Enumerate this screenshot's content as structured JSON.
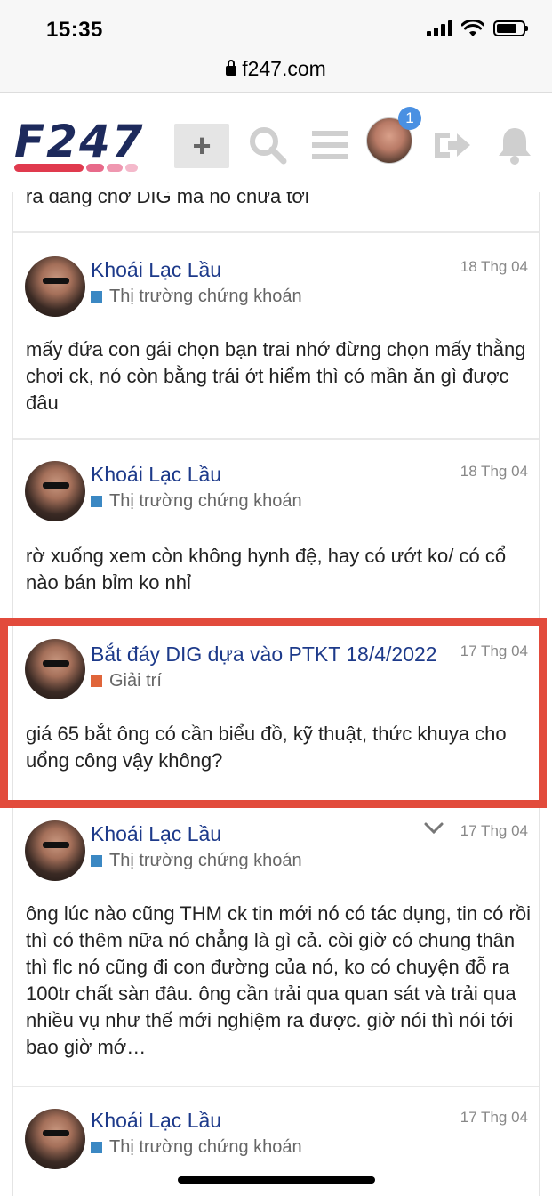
{
  "status_bar": {
    "time": "15:35"
  },
  "browser": {
    "url": "f247.com"
  },
  "header": {
    "logo_text": "F247",
    "plus_label": "+",
    "notification_count": "1",
    "icons": [
      "search-icon",
      "menu-icon",
      "avatar",
      "logout-icon",
      "bell-icon"
    ]
  },
  "feed": {
    "partial_top_text": "ra đang chờ DIG mà nó chưa tới",
    "posts": [
      {
        "title": "Khoái Lạc Lầu",
        "date": "18 Thg 04",
        "category": "Thị trường chứng khoán",
        "category_color": "#3b88c3",
        "body": "mấy đứa con gái chọn bạn trai nhớ đừng chọn mấy thằng chơi ck, nó còn bằng trái ớt hiểm thì có mần ăn gì được đâu"
      },
      {
        "title": "Khoái Lạc Lầu",
        "date": "18 Thg 04",
        "category": "Thị trường chứng khoán",
        "category_color": "#3b88c3",
        "body": "rờ xuống xem còn không hynh đệ, hay có ướt ko/ có cổ nào bán bỉm ko nhỉ"
      },
      {
        "title": "Bắt đáy DIG dựa vào PTKT 18/4/2022",
        "date": "17 Thg 04",
        "category": "Giải trí",
        "category_color": "#e0653a",
        "body": "giá 65 bắt ông có cần biểu đồ, kỹ thuật, thức khuya cho uổng công vậy không?"
      },
      {
        "title": "Khoái Lạc Lầu",
        "date": "17 Thg 04",
        "category": "Thị trường chứng khoán",
        "category_color": "#3b88c3",
        "body": "ông lúc nào cũng THM ck tin mới nó có tác dụng, tin có rồi thì có thêm nữa nó chẳng là gì cả. còi giờ có chung thân thì flc nó cũng đi con đường của nó, ko có chuyện đỗ ra 100tr chất sàn đâu. ông cần trải qua quan sát và trải qua nhiều vụ như thế mới nghiệm ra được. giờ nói thì nói tới bao giờ mớ…"
      },
      {
        "title": "Khoái Lạc Lầu",
        "date": "17 Thg 04",
        "category": "Thị trường chứng khoán",
        "category_color": "#3b88c3",
        "body": ""
      }
    ]
  }
}
